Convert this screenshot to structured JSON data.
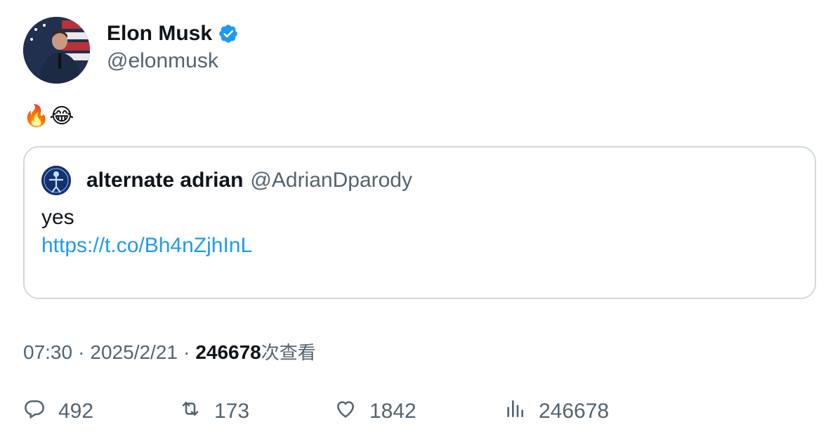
{
  "author": {
    "name": "Elon Musk",
    "handle": "@elonmusk",
    "verified": true
  },
  "tweet": {
    "text": "🔥😂"
  },
  "quote": {
    "name": "alternate adrian",
    "handle": "@AdrianDparody",
    "text": "yes",
    "link": "https://t.co/Bh4nZjhInL"
  },
  "meta": {
    "time": "07:30",
    "separator": "·",
    "date": "2025/2/21",
    "views_count": "246678",
    "views_label": "次查看"
  },
  "actions": {
    "replies": "492",
    "retweets": "173",
    "likes": "1842",
    "views": "246678"
  },
  "colors": {
    "accent": "#1d9bf0",
    "secondary_text": "#536471",
    "border": "#cfd9de"
  }
}
